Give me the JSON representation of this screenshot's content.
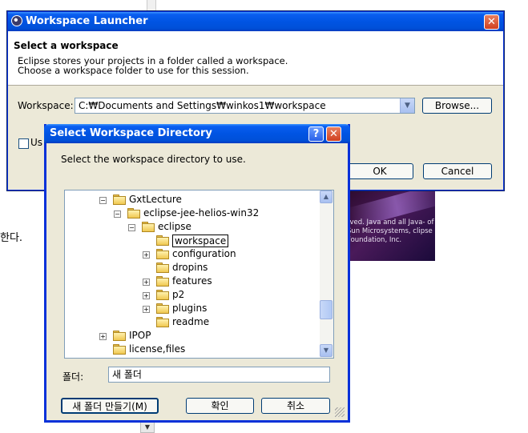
{
  "background": {
    "korean_text": "한다.",
    "splash_text": "rved. Java and all Java- of Sun Microsystems, clipse Foundation, Inc."
  },
  "launcher": {
    "title": "Workspace Launcher",
    "heading": "Select a workspace",
    "desc_line1": "Eclipse stores your projects in a folder called a workspace.",
    "desc_line2": "Choose a workspace folder to use for this session.",
    "workspace_label": "Workspace:",
    "workspace_value": "C:₩Documents and Settings₩winkos1₩workspace",
    "browse_label": "Browse...",
    "checkbox_label_visible": "Us",
    "ok_label": "OK",
    "cancel_label": "Cancel"
  },
  "dialog": {
    "title": "Select Workspace Directory",
    "help_glyph": "?",
    "instruction": "Select the workspace directory to use.",
    "tree": [
      {
        "label": "GxtLecture",
        "expander": "−",
        "selected": false
      },
      {
        "label": "eclipse-jee-helios-win32",
        "expander": "−",
        "selected": false
      },
      {
        "label": "eclipse",
        "expander": "−",
        "selected": false
      },
      {
        "label": "workspace",
        "expander": "",
        "selected": true
      },
      {
        "label": "configuration",
        "expander": "+",
        "selected": false
      },
      {
        "label": "dropins",
        "expander": "",
        "selected": false
      },
      {
        "label": "features",
        "expander": "+",
        "selected": false
      },
      {
        "label": "p2",
        "expander": "+",
        "selected": false
      },
      {
        "label": "plugins",
        "expander": "+",
        "selected": false
      },
      {
        "label": "readme",
        "expander": "",
        "selected": false
      },
      {
        "label": "IPOP",
        "expander": "+",
        "selected": false
      },
      {
        "label": "license,files",
        "expander": "",
        "selected": false
      }
    ],
    "folder_label": "폴더:",
    "folder_value": "새 폴더",
    "new_folder_label": "새 폴더 만들기(M)",
    "confirm_label": "확인",
    "cancel_label": "취소"
  }
}
